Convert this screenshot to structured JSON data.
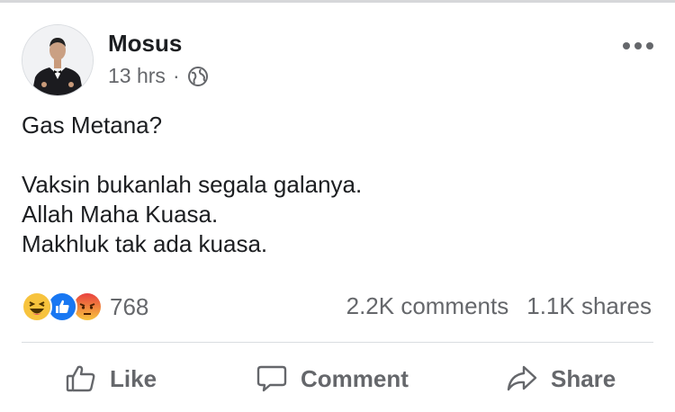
{
  "post": {
    "author": "Mosus",
    "time": "13 hrs",
    "separator": "·",
    "privacy_icon": "globe-icon",
    "more_icon": "more-options-icon",
    "text_lines": [
      "Gas Metana?",
      "",
      "Vaksin bukanlah segala galanya.",
      "Allah Maha Kuasa.",
      "Makhluk tak ada kuasa."
    ]
  },
  "reactions": {
    "icons": [
      "haha-icon",
      "like-icon",
      "angry-icon"
    ],
    "count": "768"
  },
  "stats": {
    "comments": "2.2K comments",
    "shares": "1.1K shares"
  },
  "actions": {
    "like": "Like",
    "comment": "Comment",
    "share": "Share"
  },
  "colors": {
    "text": "#1c1e21",
    "secondary": "#65676b",
    "like_blue": "#1877f2",
    "haha_yellow": "#f7c33d",
    "angry_red": "#e9710f"
  }
}
